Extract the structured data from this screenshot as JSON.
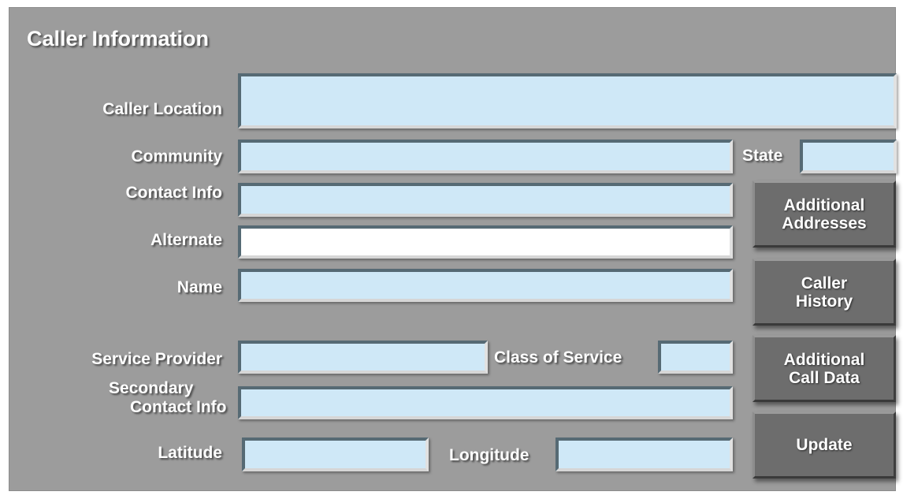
{
  "title": "Caller Information",
  "labels": {
    "caller_location": "Caller Location",
    "community": "Community",
    "state": "State",
    "contact_info": "Contact Info",
    "alternate": "Alternate",
    "name": "Name",
    "service_provider": "Service Provider",
    "class_of_service": "Class of Service",
    "secondary_line1": "Secondary",
    "secondary_line2": "Contact Info",
    "latitude": "Latitude",
    "longitude": "Longitude"
  },
  "fields": {
    "caller_location": "",
    "community": "",
    "state": "",
    "contact_info": "",
    "alternate": "",
    "name": "",
    "service_provider": "",
    "class_of_service": "",
    "secondary_contact_info": "",
    "latitude": "",
    "longitude": ""
  },
  "buttons": {
    "additional_addresses": "Additional\nAddresses",
    "caller_history": "Caller\nHistory",
    "additional_call_data": "Additional\nCall Data",
    "update": "Update"
  },
  "colors": {
    "panel": "#9c9c9c",
    "field": "#cfe8f7",
    "field_active": "#ffffff",
    "button": "#6d6d6d"
  }
}
